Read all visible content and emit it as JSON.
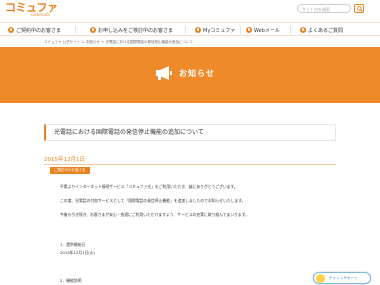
{
  "header": {
    "logo": "コミュファ",
    "logo_sub": "commufa",
    "search_placeholder": "サイト内を検索"
  },
  "nav": {
    "items": [
      {
        "label": "ご契約中のお客さま"
      },
      {
        "label": "お申し込みをご検討中のお客さま"
      },
      {
        "label": "Myコミュファ"
      },
      {
        "label": "Webメール"
      },
      {
        "label": "よくあるご質問"
      }
    ]
  },
  "breadcrumb": "コミュファ 公式サイト ＞ お知らせ ＞ 光電話における国際電話の発信停止機能の追加について",
  "hero": {
    "title": "お知らせ"
  },
  "article": {
    "title": "光電話における国際電話の発信停止機能の追加について",
    "date": "2015年12月1日",
    "badge": "ご契約中のお客さま",
    "paragraphs": [
      "平素よりインターネット接続サービス「コミュファ光」をご利用いただき、誠にありがとうございます。",
      "この度、光電話の付加サービスとして「国際電話の発信停止機能」を追加しましたのでお知らせいたします。",
      "今後も引き続き、お客さまが安心・快適にご利用いただけますよう、サービスの充実に取り組んでまいります。",
      "1．提供開始日",
      "2015年12月1日(火)",
      "2．機能説明"
    ]
  },
  "chat": {
    "label": "チャットサポート"
  }
}
